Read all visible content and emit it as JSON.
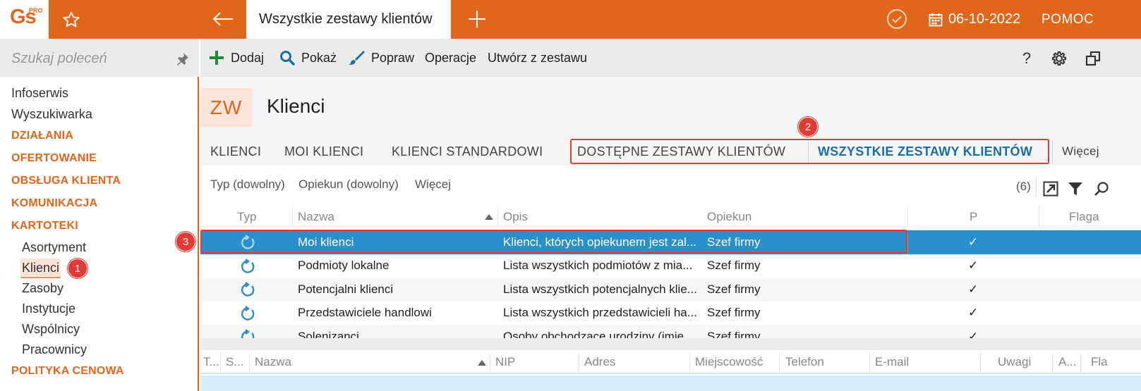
{
  "app": {
    "logo_text": "Gs",
    "logo_badge": "PRO",
    "active_tab": "Wszystkie zestawy klientów",
    "date": "06-10-2022",
    "help_label": "POMOC"
  },
  "sidebar": {
    "search_placeholder": "Szukaj poleceń",
    "items": [
      {
        "label": "Infoserwis"
      },
      {
        "label": "Wyszukiwarka"
      }
    ],
    "categories": [
      {
        "label": "DZIAŁANIA"
      },
      {
        "label": "OFERTOWANIE"
      },
      {
        "label": "OBSŁUGA KLIENTA"
      },
      {
        "label": "KOMUNIKACJA"
      },
      {
        "label": "KARTOTEKI"
      }
    ],
    "sub_items": [
      {
        "label": "Asortyment"
      },
      {
        "label": "Klienci"
      },
      {
        "label": "Zasoby"
      },
      {
        "label": "Instytucje"
      },
      {
        "label": "Wspólnicy"
      },
      {
        "label": "Pracownicy"
      }
    ],
    "last_category": "POLITYKA CENOWA"
  },
  "toolbar": {
    "add_label": "Dodaj",
    "show_label": "Pokaż",
    "edit_label": "Popraw",
    "operations_label": "Operacje",
    "create_label": "Utwórz z zestawu",
    "help_symbol": "?"
  },
  "page": {
    "badge": "ZW",
    "title": "Klienci"
  },
  "tabs": {
    "items": [
      {
        "label": "KLIENCI"
      },
      {
        "label": "MOI KLIENCI"
      },
      {
        "label": "KLIENCI STANDARDOWI"
      },
      {
        "label": "DOSTĘPNE ZESTAWY KLIENTÓW"
      },
      {
        "label": "WSZYSTKIE ZESTAWY KLIENTÓW"
      }
    ],
    "more_label": "Więcej"
  },
  "filters": {
    "type_label": "Typ (dowolny)",
    "owner_label": "Opiekun (dowolny)",
    "more_label": "Więcej",
    "count": "(6)"
  },
  "grid": {
    "columns": [
      "Typ",
      "Nazwa",
      "Opis",
      "Opiekun",
      "P",
      "Flaga"
    ],
    "rows": [
      {
        "name": "Moi klienci",
        "desc": "Klienci, których opiekunem jest zal...",
        "owner": "Szef firmy",
        "p": "✓"
      },
      {
        "name": "Podmioty lokalne",
        "desc": "Lista wszystkich podmiotów z mia...",
        "owner": "Szef firmy",
        "p": "✓"
      },
      {
        "name": "Potencjalni klienci",
        "desc": "Lista wszystkich potencjalnych klie...",
        "owner": "Szef firmy",
        "p": "✓"
      },
      {
        "name": "Przedstawiciele handlowi",
        "desc": "Lista wszystkich przedstawicieli ha...",
        "owner": "Szef firmy",
        "p": "✓"
      },
      {
        "name": "Solenizanci",
        "desc": "Osoby obchodzące urodziny (imie...",
        "owner": "Szef firmy",
        "p": "✓"
      }
    ]
  },
  "grid2": {
    "columns": [
      "T...",
      "S...",
      "Nazwa",
      "NIP",
      "Adres",
      "Miejscowość",
      "Telefon",
      "E-mail",
      "Uwagi",
      "A...",
      "Fla"
    ]
  },
  "annotations": {
    "step1": "1",
    "step2": "2",
    "step3": "3"
  },
  "colors": {
    "brand": "#e0661c",
    "selection": "#2c8fcd",
    "active_tab_text": "#1a6fa8",
    "annotation": "#e53935"
  }
}
